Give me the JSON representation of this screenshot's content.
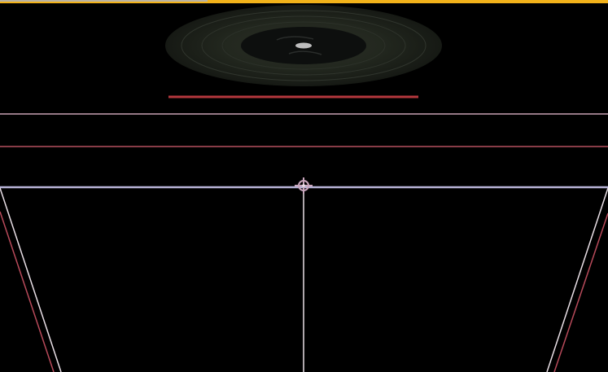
{
  "window": {
    "accent_color": "#f2b21a",
    "background_color": "#000000"
  },
  "scene": {
    "record": {
      "icon": "vinyl-record",
      "disc_color": "#1b1f1a",
      "groove_color": "#2d322b",
      "label_color": "#0c0e0d",
      "spindle_color": "#bfbfbf"
    },
    "guide_colors": {
      "red": "#c0393f",
      "pink": "#c78aa0",
      "lavender": "#b8b4d8",
      "white": "#e9dfe6"
    },
    "gizmo": {
      "icon": "transform-gizmo-crosshair"
    }
  }
}
